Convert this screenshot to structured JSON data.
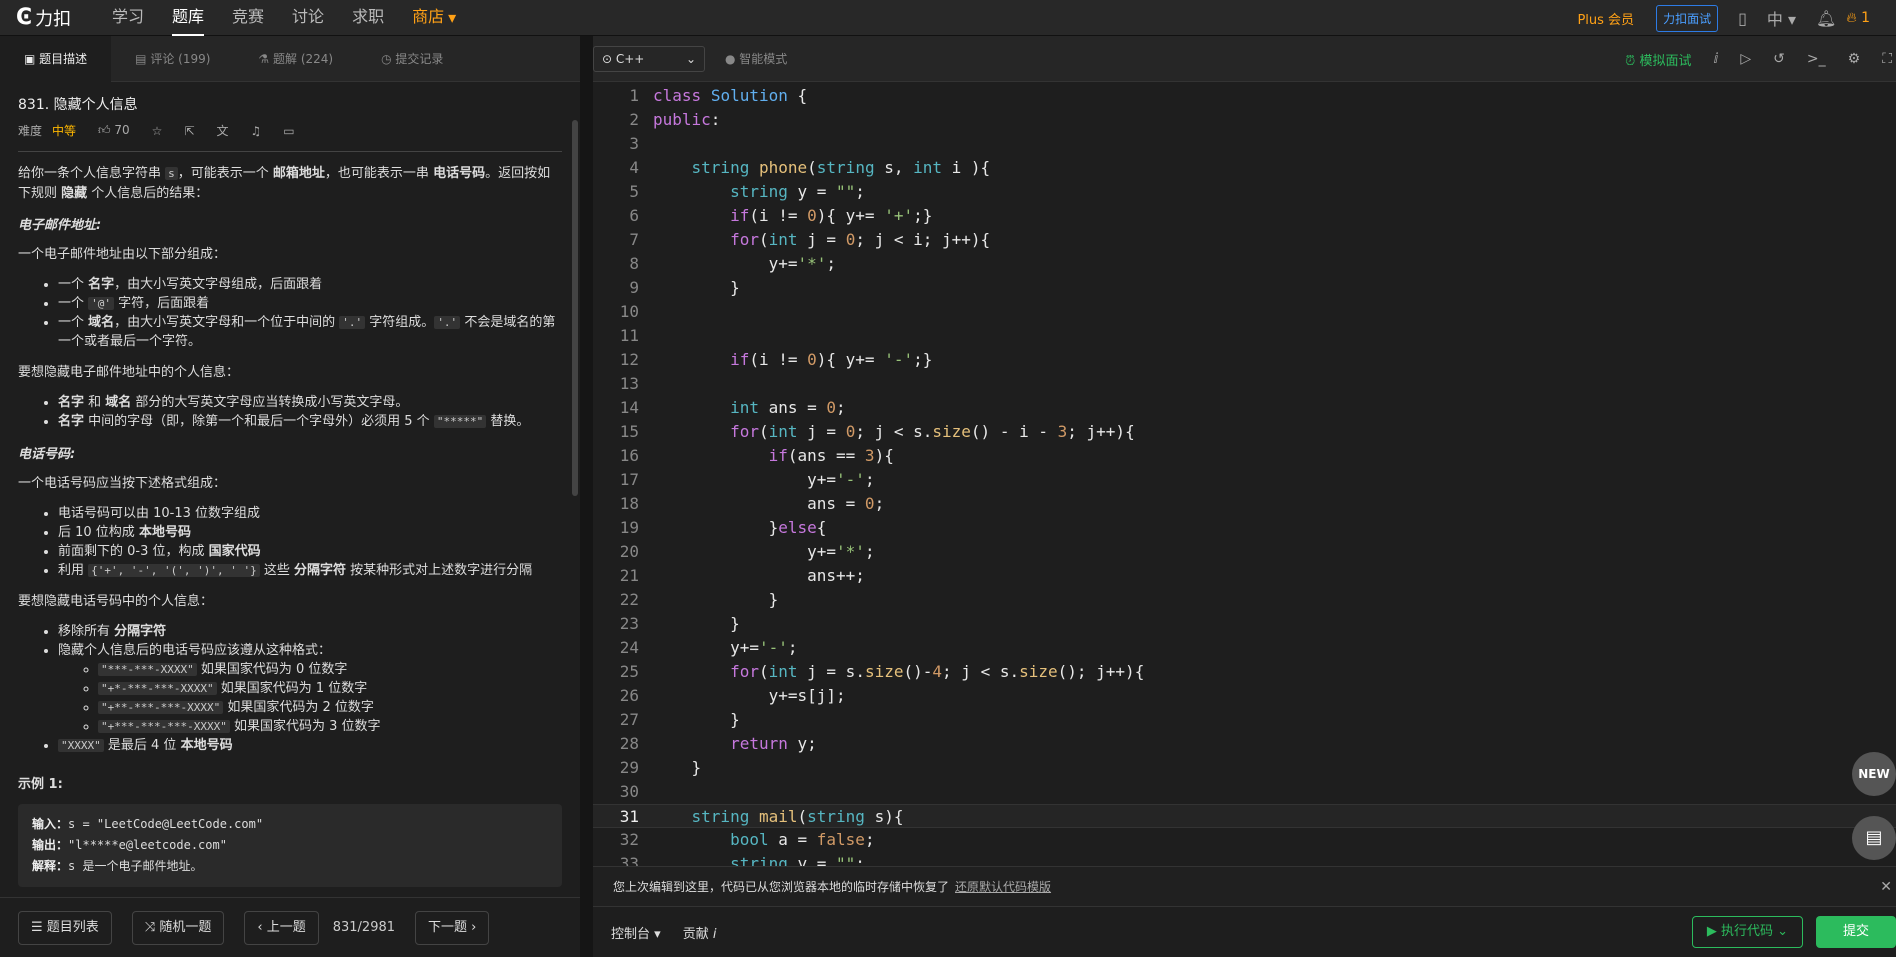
{
  "topbar": {
    "logo": "力扣",
    "nav": [
      "学习",
      "题库",
      "竞赛",
      "讨论",
      "求职",
      "商店"
    ],
    "plus": "Plus 会员",
    "interview": "力扣面试",
    "lang": "中",
    "fire_count": "1"
  },
  "left": {
    "tabs": [
      "题目描述",
      "评论 (199)",
      "题解 (224)",
      "提交记录"
    ],
    "title": "831. 隐藏个人信息",
    "difficulty_label": "难度",
    "difficulty": "中等",
    "likes": "70",
    "intro": [
      "给你一条个人信息字符串 ",
      "s",
      "，可能表示一个 ",
      "邮箱地址",
      "，也可能表示一串 ",
      "电话号码",
      "。返回按如下规则 ",
      "隐藏",
      " 个人信息后的结果："
    ],
    "email_h": "电子邮件地址:",
    "email_p": "一个电子邮件地址由以下部分组成：",
    "email_items": [
      [
        "一个 ",
        "名字",
        "，由大小写英文字母组成，后面跟着"
      ],
      [
        "一个 ",
        "'@'",
        " 字符，后面跟着"
      ],
      [
        "一个 ",
        "域名",
        "，由大小写英文字母和一个位于中间的 ",
        "'.'",
        " 字符组成。",
        "'.'",
        " 不会是域名的第一个或者最后一个字符。"
      ]
    ],
    "hide_email_p": "要想隐藏电子邮件地址中的个人信息：",
    "hide_email_items": [
      [
        "名字",
        " 和 ",
        "域名",
        " 部分的大写英文字母应当转换成小写英文字母。"
      ],
      [
        "名字",
        " 中间的字母（即，除第一个和最后一个字母外）必须用 5 个 ",
        "\"*****\"",
        " 替换。"
      ]
    ],
    "phone_h": "电话号码:",
    "phone_p": "一个电话号码应当按下述格式组成：",
    "phone_items": [
      [
        "电话号码可以由 10-13 位数字组成"
      ],
      [
        "后 10 位构成 ",
        "本地号码"
      ],
      [
        "前面剩下的 0-3 位，构成 ",
        "国家代码"
      ],
      [
        "利用 ",
        "{'+', '-', '(', ')', ' '}",
        " 这些 ",
        "分隔字符",
        " 按某种形式对上述数字进行分隔"
      ]
    ],
    "hide_phone_p": "要想隐藏电话号码中的个人信息：",
    "hide_phone_1a": "移除所有 ",
    "hide_phone_1b": "分隔字符",
    "hide_phone_2": "隐藏个人信息后的电话号码应该遵从这种格式：",
    "formats": [
      [
        "\"***-***-XXXX\"",
        " 如果国家代码为 0 位数字"
      ],
      [
        "\"+*-***-***-XXXX\"",
        " 如果国家代码为 1 位数字"
      ],
      [
        "\"+**-***-***-XXXX\"",
        " 如果国家代码为 2 位数字"
      ],
      [
        "\"+***-***-***-XXXX\"",
        " 如果国家代码为 3 位数字"
      ]
    ],
    "last_item_code": "\"XXXX\"",
    "last_item_a": " 是最后 4 位 ",
    "last_item_b": "本地号码",
    "example_h": "示例 1:",
    "ex_in_label": "输入：",
    "ex_in": "s = \"LeetCode@LeetCode.com\"",
    "ex_out_label": "输出：",
    "ex_out": "\"l*****e@leetcode.com\"",
    "ex_exp_label": "解释：",
    "ex_exp": "s 是一个电子邮件地址。",
    "footer": {
      "list": "题目列表",
      "random": "随机一题",
      "prev": "上一题",
      "page": "831/2981",
      "next": "下一题"
    }
  },
  "editor": {
    "language": "C++",
    "smart_mode": "智能模式",
    "mock": "模拟面试",
    "current_line": 31,
    "lines": [
      "class Solution {",
      "public:",
      "",
      "    string phone(string s, int i ){",
      "        string y = \"\";",
      "        if(i != 0){ y+= '+';}",
      "        for(int j = 0; j < i; j++){",
      "            y+='*';",
      "        }",
      "",
      "",
      "        if(i != 0){ y+= '-';}",
      "",
      "        int ans = 0;",
      "        for(int j = 0; j < s.size() - i - 3; j++){",
      "            if(ans == 3){",
      "                y+='-';",
      "                ans = 0;",
      "            }else{",
      "                y+='*';",
      "                ans++;",
      "            }",
      "        }",
      "        y+='-';",
      "        for(int j = s.size()-4; j < s.size(); j++){",
      "            y+=s[j];",
      "        }",
      "        return y;",
      "    }",
      "",
      "    string mail(string s){",
      "        bool a = false;",
      "        string y = \"\";"
    ],
    "toast": "您上次编辑到这里，代码已从您浏览器本地的临时存储中恢复了",
    "toast_link": "还原默认代码模版",
    "console": "控制台",
    "contribute": "贡献",
    "run": "执行代码",
    "submit": "提交",
    "fab_new": "NEW"
  }
}
